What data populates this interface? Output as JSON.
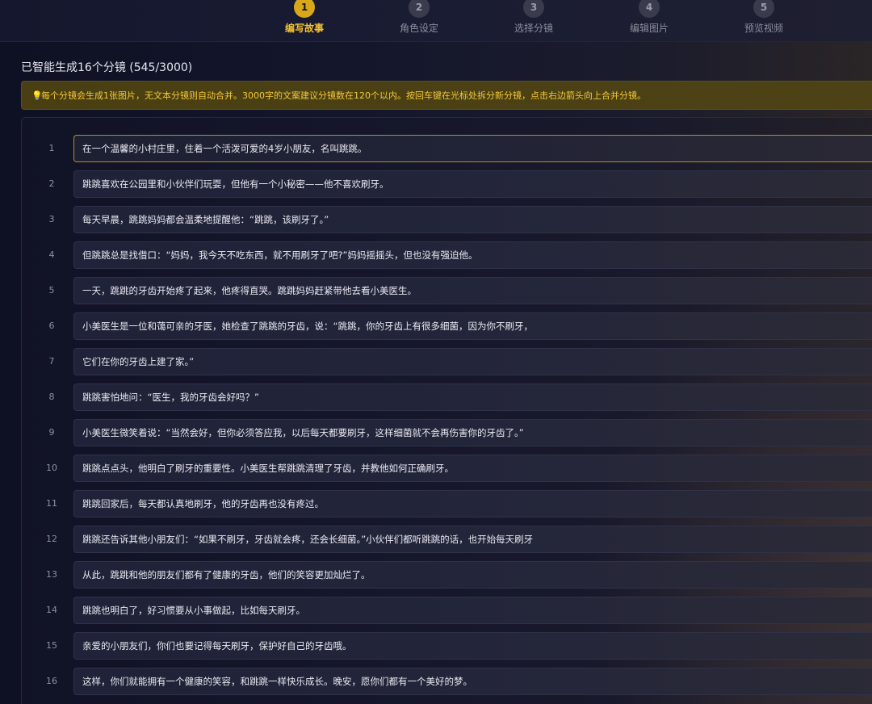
{
  "steps": [
    {
      "num": "1",
      "label": "编写故事"
    },
    {
      "num": "2",
      "label": "角色设定"
    },
    {
      "num": "3",
      "label": "选择分镜"
    },
    {
      "num": "4",
      "label": "编辑图片"
    },
    {
      "num": "5",
      "label": "预览视频"
    }
  ],
  "active_step": 1,
  "summary": "已智能生成16个分镜 (545/3000)",
  "notice": {
    "icon": "lightbulb-icon",
    "text": "每个分镜会生成1张图片，无文本分镜则自动合并。3000字的文案建议分镜数在120个以内。按回车键在光标处拆分新分镜，点击右边箭头向上合并分镜。"
  },
  "colors": {
    "accent": "#f2c230",
    "active_circle": "#d9a81a",
    "background": "#0f1124"
  },
  "shots": [
    {
      "num": "1",
      "text": "在一个温馨的小村庄里，住着一个活泼可爱的4岁小朋友，名叫跳跳。"
    },
    {
      "num": "2",
      "text": "跳跳喜欢在公园里和小伙伴们玩耍，但他有一个小秘密——他不喜欢刷牙。"
    },
    {
      "num": "3",
      "text": "每天早晨，跳跳妈妈都会温柔地提醒他：“跳跳，该刷牙了。”"
    },
    {
      "num": "4",
      "text": "但跳跳总是找借口：“妈妈，我今天不吃东西，就不用刷牙了吧?”妈妈摇摇头，但也没有强迫他。"
    },
    {
      "num": "5",
      "text": "一天，跳跳的牙齿开始疼了起来，他疼得直哭。跳跳妈妈赶紧带他去看小美医生。"
    },
    {
      "num": "6",
      "text": "小美医生是一位和蔼可亲的牙医，她检查了跳跳的牙齿，说：“跳跳，你的牙齿上有很多细菌，因为你不刷牙，"
    },
    {
      "num": "7",
      "text": "它们在你的牙齿上建了家。”"
    },
    {
      "num": "8",
      "text": "跳跳害怕地问：“医生，我的牙齿会好吗？”"
    },
    {
      "num": "9",
      "text": "小美医生微笑着说：“当然会好，但你必须答应我，以后每天都要刷牙，这样细菌就不会再伤害你的牙齿了。”"
    },
    {
      "num": "10",
      "text": "跳跳点点头，他明白了刷牙的重要性。小美医生帮跳跳清理了牙齿，并教他如何正确刷牙。"
    },
    {
      "num": "11",
      "text": "跳跳回家后，每天都认真地刷牙，他的牙齿再也没有疼过。"
    },
    {
      "num": "12",
      "text": "跳跳还告诉其他小朋友们：“如果不刷牙，牙齿就会疼，还会长细菌。”小伙伴们都听跳跳的话，也开始每天刷牙"
    },
    {
      "num": "13",
      "text": "从此，跳跳和他的朋友们都有了健康的牙齿，他们的笑容更加灿烂了。"
    },
    {
      "num": "14",
      "text": "跳跳也明白了，好习惯要从小事做起，比如每天刷牙。"
    },
    {
      "num": "15",
      "text": "亲爱的小朋友们，你们也要记得每天刷牙，保护好自己的牙齿哦。"
    },
    {
      "num": "16",
      "text": "这样，你们就能拥有一个健康的笑容，和跳跳一样快乐成长。晚安，愿你们都有一个美好的梦。"
    }
  ]
}
